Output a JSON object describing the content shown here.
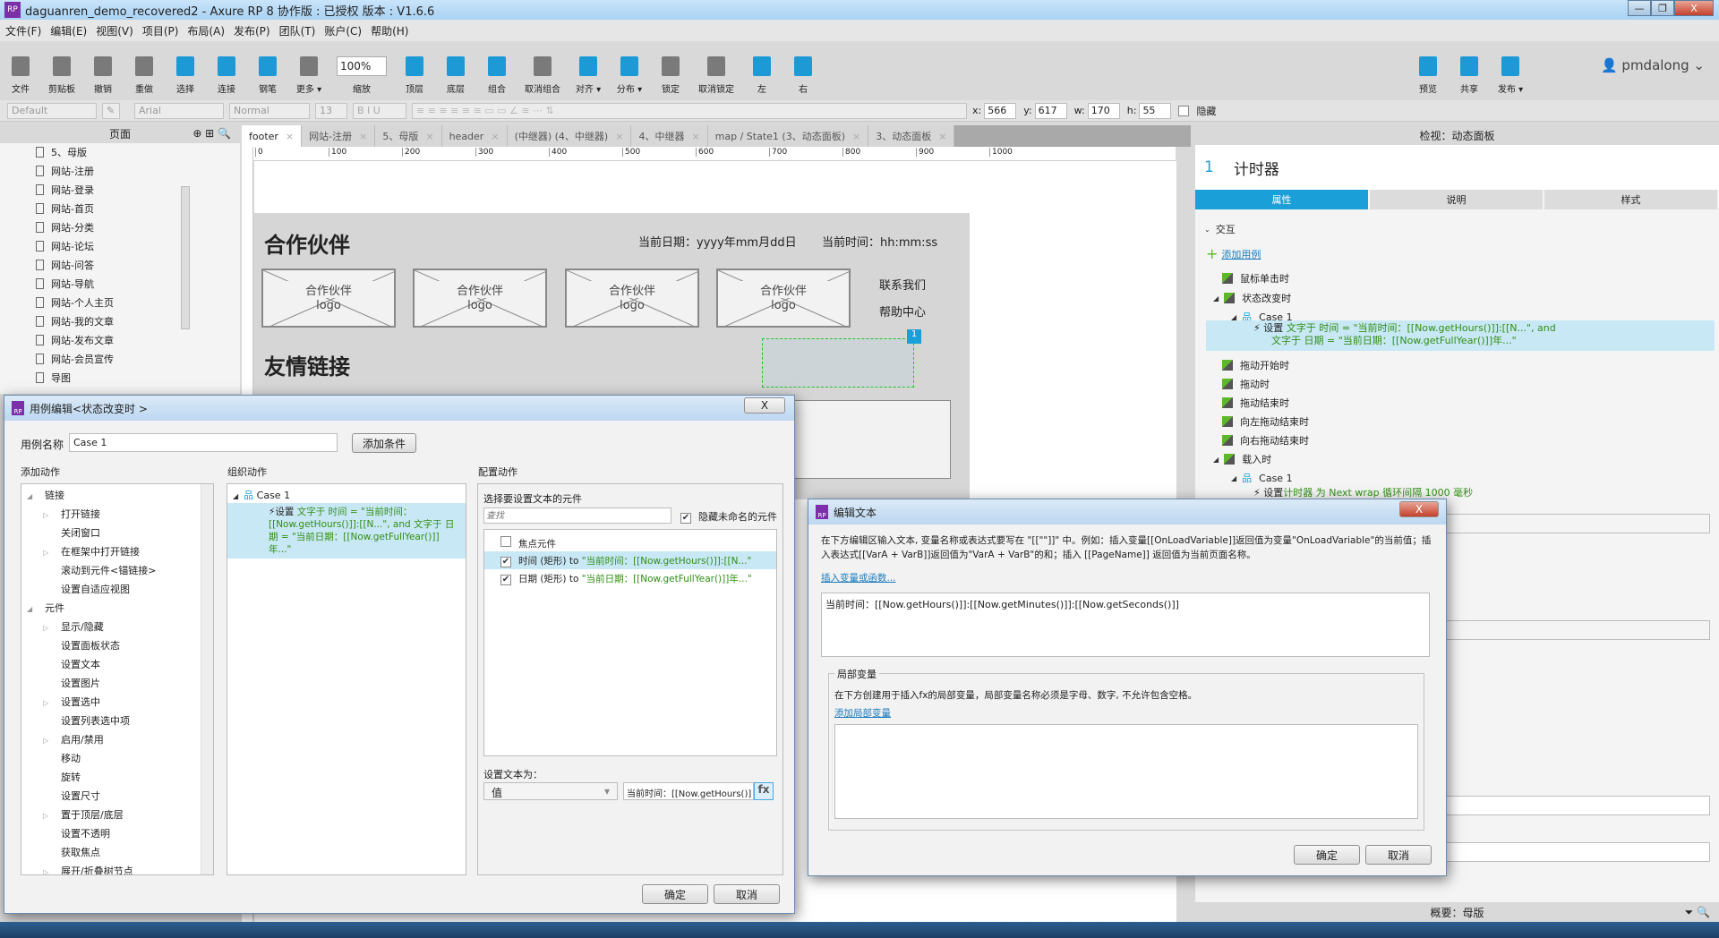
{
  "window": {
    "title": "daguanren_demo_recovered2 - Axure RP 8 协作版 : 已授权 版本 : V1.6.6",
    "app_icon": "RP",
    "minimize": "—",
    "restore": "❐",
    "close": "X"
  },
  "menu": [
    "文件(F)",
    "编辑(E)",
    "视图(V)",
    "项目(P)",
    "布局(A)",
    "发布(P)",
    "团队(T)",
    "账户(C)",
    "帮助(H)"
  ],
  "toolbar": {
    "items": [
      "文件",
      "剪贴板",
      "撤销",
      "重做",
      "选择",
      "连接",
      "钢笔",
      "更多 ▾",
      "缩放",
      "顶层",
      "底层",
      "组合",
      "取消组合",
      "对齐 ▾",
      "分布 ▾",
      "锁定",
      "取消锁定",
      "左",
      "右",
      "预览",
      "共享",
      "发布 ▾"
    ],
    "zoom": "100%",
    "user": "pmdalong"
  },
  "format": {
    "style": "Default",
    "font": "Arial",
    "weight": "Normal",
    "size": "13",
    "x_label": "x:",
    "x": "566",
    "y_label": "y:",
    "y": "617",
    "w_label": "w:",
    "w": "170",
    "h_label": "h:",
    "h": "55",
    "hidden": "隐藏"
  },
  "pages": {
    "title": "页面",
    "items": [
      "5、母版",
      "网站-注册",
      "网站-登录",
      "网站-首页",
      "网站-分类",
      "网站-论坛",
      "网站-问答",
      "网站-导航",
      "网站-个人主页",
      "网站-我的文章",
      "网站-发布文章",
      "网站-会员宣传",
      "导图"
    ]
  },
  "tabs": [
    "footer",
    "网站-注册",
    "5、母版",
    "header",
    "(中继器) (4、中继器)",
    "4、中继器",
    "map / State1 (3、动态面板)",
    "3、动态面板"
  ],
  "ruler": [
    "0",
    "100",
    "200",
    "300",
    "400",
    "500",
    "600",
    "700",
    "800",
    "900",
    "1000"
  ],
  "canvas": {
    "title1": "合作伙伴",
    "date": "当前日期：yyyy年mm月dd日",
    "time": "当前时间：hh:mm:ss",
    "placeholder_line1": "合作伙伴",
    "placeholder_line2": "logo",
    "contact": "联系我们",
    "help": "帮助中心",
    "title2": "友情链接",
    "badge": "1"
  },
  "inspector": {
    "header": "检视：动态面板",
    "index": "1",
    "name": "计时器",
    "tabs": [
      "属性",
      "说明",
      "样式"
    ],
    "section": "交互",
    "add_case": "添加用例",
    "events": [
      "鼠标单击时",
      "状态改变时",
      "拖动开始时",
      "拖动时",
      "拖动结束时",
      "向左拖动结束时",
      "向右拖动结束时",
      "载入时"
    ],
    "case": "Case 1",
    "action1_a": "设置 ",
    "action1_b": "文字于 时间 = \"当前时间：[[Now.getHours()]]:[[N...\", and",
    "action1_c": "文字于 日期 = \"当前日期：[[Now.getFullYear()]]年...\"",
    "action2_a": "设置 ",
    "action2_b": "计时器 为 Next wrap 循环间隔 1000 毫秒",
    "footer": "概要：母版"
  },
  "case_dialog": {
    "title": "用例编辑<状态改变时 >",
    "name_label": "用例名称",
    "name_value": "Case 1",
    "add_condition": "添加条件",
    "add_action": "添加动作",
    "organize": "组织动作",
    "configure": "配置动作",
    "actions": [
      {
        "t": "链接",
        "lvl": 0,
        "exp": true
      },
      {
        "t": "打开链接",
        "lvl": 1,
        "exp": false
      },
      {
        "t": "关闭窗口",
        "lvl": 1
      },
      {
        "t": "在框架中打开链接",
        "lvl": 1,
        "exp": false
      },
      {
        "t": "滚动到元件<锚链接>",
        "lvl": 1
      },
      {
        "t": "设置自适应视图",
        "lvl": 1
      },
      {
        "t": "元件",
        "lvl": 0,
        "exp": true
      },
      {
        "t": "显示/隐藏",
        "lvl": 1,
        "exp": false
      },
      {
        "t": "设置面板状态",
        "lvl": 1
      },
      {
        "t": "设置文本",
        "lvl": 1
      },
      {
        "t": "设置图片",
        "lvl": 1
      },
      {
        "t": "设置选中",
        "lvl": 1,
        "exp": false
      },
      {
        "t": "设置列表选中项",
        "lvl": 1
      },
      {
        "t": "启用/禁用",
        "lvl": 1,
        "exp": false
      },
      {
        "t": "移动",
        "lvl": 1
      },
      {
        "t": "旋转",
        "lvl": 1
      },
      {
        "t": "设置尺寸",
        "lvl": 1
      },
      {
        "t": "置于顶层/底层",
        "lvl": 1,
        "exp": false
      },
      {
        "t": "设置不透明",
        "lvl": 1
      },
      {
        "t": "获取焦点",
        "lvl": 1
      },
      {
        "t": "展开/折叠树节点",
        "lvl": 1,
        "exp": false
      }
    ],
    "case": "Case 1",
    "org_action_a": "设置 ",
    "org_action_b": "文字于 时间 = \"当前时间：[[Now.getHours()]]:[[N...\", and 文字于 日期 = \"当前日期：[[Now.getFullYear()]]年...\"",
    "select_label": "选择要设置文本的元件",
    "search_placeholder": "查找",
    "hide_unnamed": "隐藏未命名的元件",
    "widgets": [
      {
        "name": "焦点元件",
        "checked": false,
        "value": ""
      },
      {
        "name": "时间 (矩形) to ",
        "checked": true,
        "value": "\"当前时间：[[Now.getHours()]]:[[N...\""
      },
      {
        "name": "日期 (矩形) to ",
        "checked": true,
        "value": "\"当前日期：[[Now.getFullYear()]]年...\""
      }
    ],
    "set_text_label": "设置文本为：",
    "set_text_type": "值",
    "set_text_value": "当前时间：[[Now.getHours()]",
    "fx": "fx",
    "ok": "确定",
    "cancel": "取消",
    "close": "X"
  },
  "edit_dialog": {
    "title": "编辑文本",
    "close": "X",
    "desc": "在下方编辑区输入文本, 变量名称或表达式要写在 \"[[\"\"]]\" 中。例如：插入变量[[OnLoadVariable]]返回值为变量\"OnLoadVariable\"的当前值；插入表达式[[VarA + VarB]]返回值为\"VarA + VarB\"的和；插入 [[PageName]] 返回值为当前页面名称。",
    "insert_link": "插入变量或函数...",
    "text": "当前时间：[[Now.getHours()]]:[[Now.getMinutes()]]:[[Now.getSeconds()]]",
    "local_title": "局部变量",
    "local_desc": "在下方创建用于插入fx的局部变量，局部变量名称必须是字母、数字, 不允许包含空格。",
    "add_local": "添加局部变量",
    "ok": "确定",
    "cancel": "取消"
  },
  "colors": {
    "accent": "#1a9fd8",
    "action_green": "#2f8f12",
    "selection": "#c9e8f5",
    "brand": "#7b2fa8"
  }
}
